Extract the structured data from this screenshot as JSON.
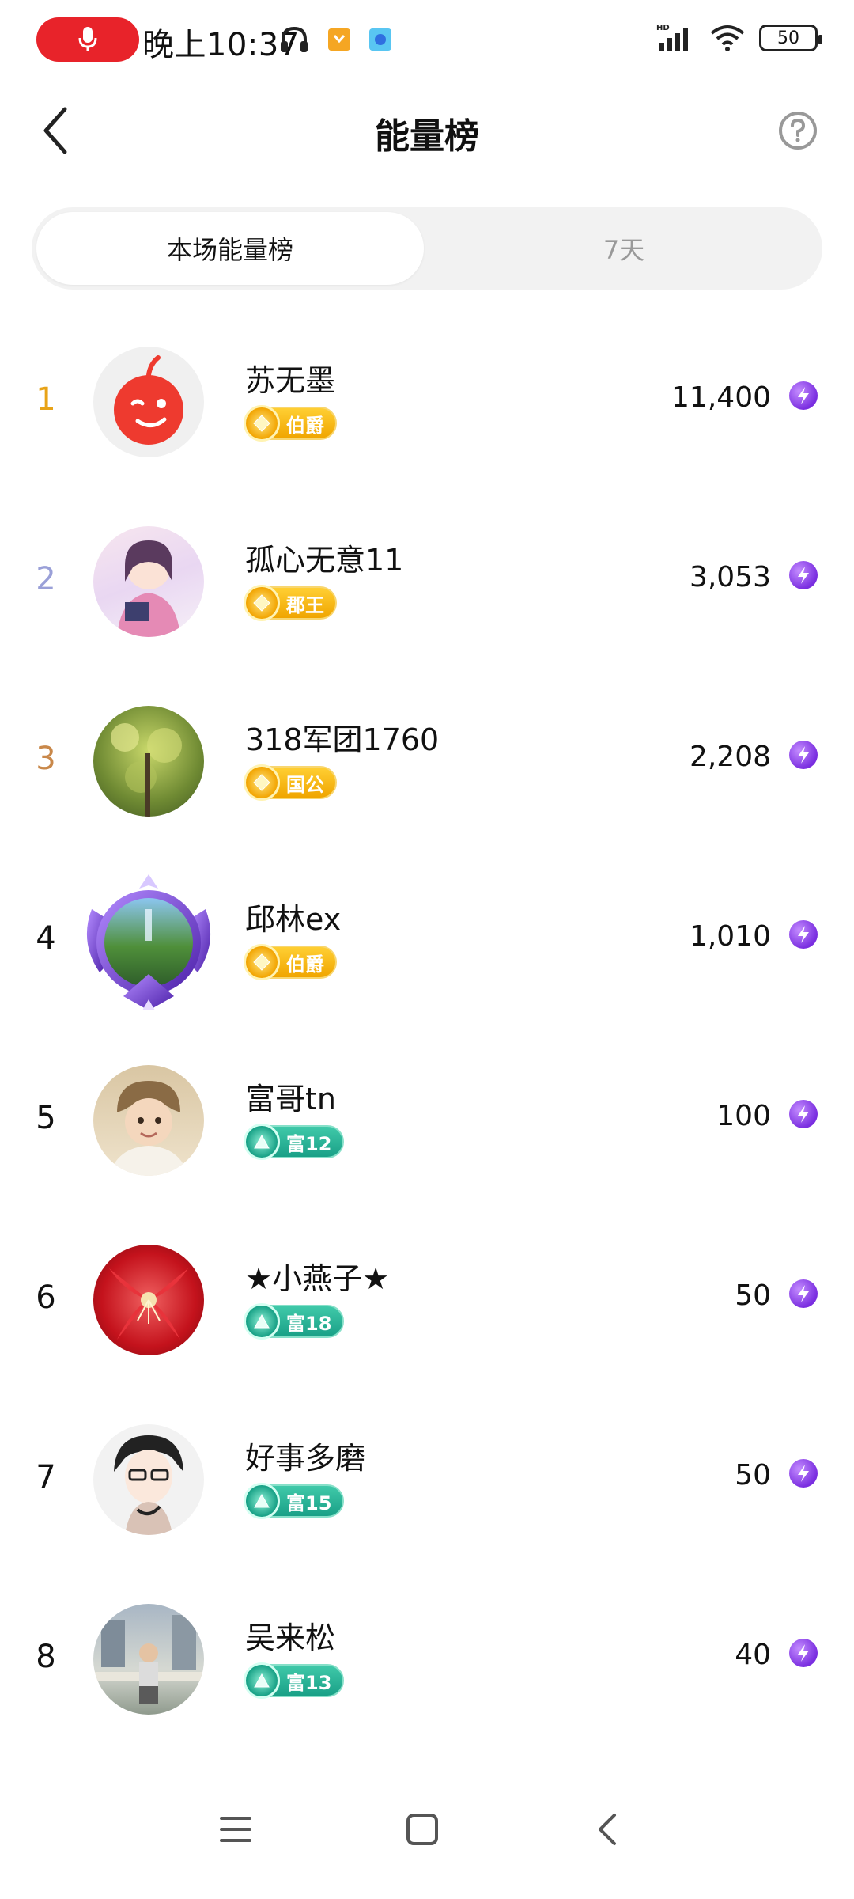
{
  "status_bar": {
    "time": "晚上10:37",
    "battery": "50",
    "network": "HD"
  },
  "header": {
    "title": "能量榜"
  },
  "tabs": [
    {
      "label": "本场能量榜",
      "active": true
    },
    {
      "label": "7天",
      "active": false
    }
  ],
  "ranking": [
    {
      "rank": "1",
      "name": "苏无墨",
      "badge": "伯爵",
      "badge_type": "gold",
      "score": "11,400",
      "rank_color": "#e8a317"
    },
    {
      "rank": "2",
      "name": "孤心无意11",
      "badge": "郡王",
      "badge_type": "gold",
      "score": "3,053",
      "rank_color": "#9aa0d8"
    },
    {
      "rank": "3",
      "name": "318军团1760",
      "badge": "国公",
      "badge_type": "gold",
      "score": "2,208",
      "rank_color": "#c9884a"
    },
    {
      "rank": "4",
      "name": "邱林ex",
      "badge": "伯爵",
      "badge_type": "gold",
      "score": "1,010",
      "rank_color": "#111111"
    },
    {
      "rank": "5",
      "name": "富哥tn",
      "badge": "富12",
      "badge_type": "green",
      "score": "100",
      "rank_color": "#111111"
    },
    {
      "rank": "6",
      "name": "★小燕子★",
      "badge": "富18",
      "badge_type": "green",
      "score": "50",
      "rank_color": "#111111"
    },
    {
      "rank": "7",
      "name": "好事多磨",
      "badge": "富15",
      "badge_type": "green",
      "score": "50",
      "rank_color": "#111111"
    },
    {
      "rank": "8",
      "name": "吴来松",
      "badge": "富13",
      "badge_type": "green",
      "score": "40",
      "rank_color": "#111111"
    }
  ],
  "colors": {
    "accent_red": "#e8232a",
    "energy_purple": "#7a2ee0",
    "badge_gold": "#f0a500",
    "badge_green": "#1aa087"
  },
  "icons": [
    "microphone-icon",
    "headphones-icon",
    "back-icon",
    "help-icon",
    "energy-icon",
    "menu-icon",
    "home-icon",
    "nav-back-icon"
  ]
}
